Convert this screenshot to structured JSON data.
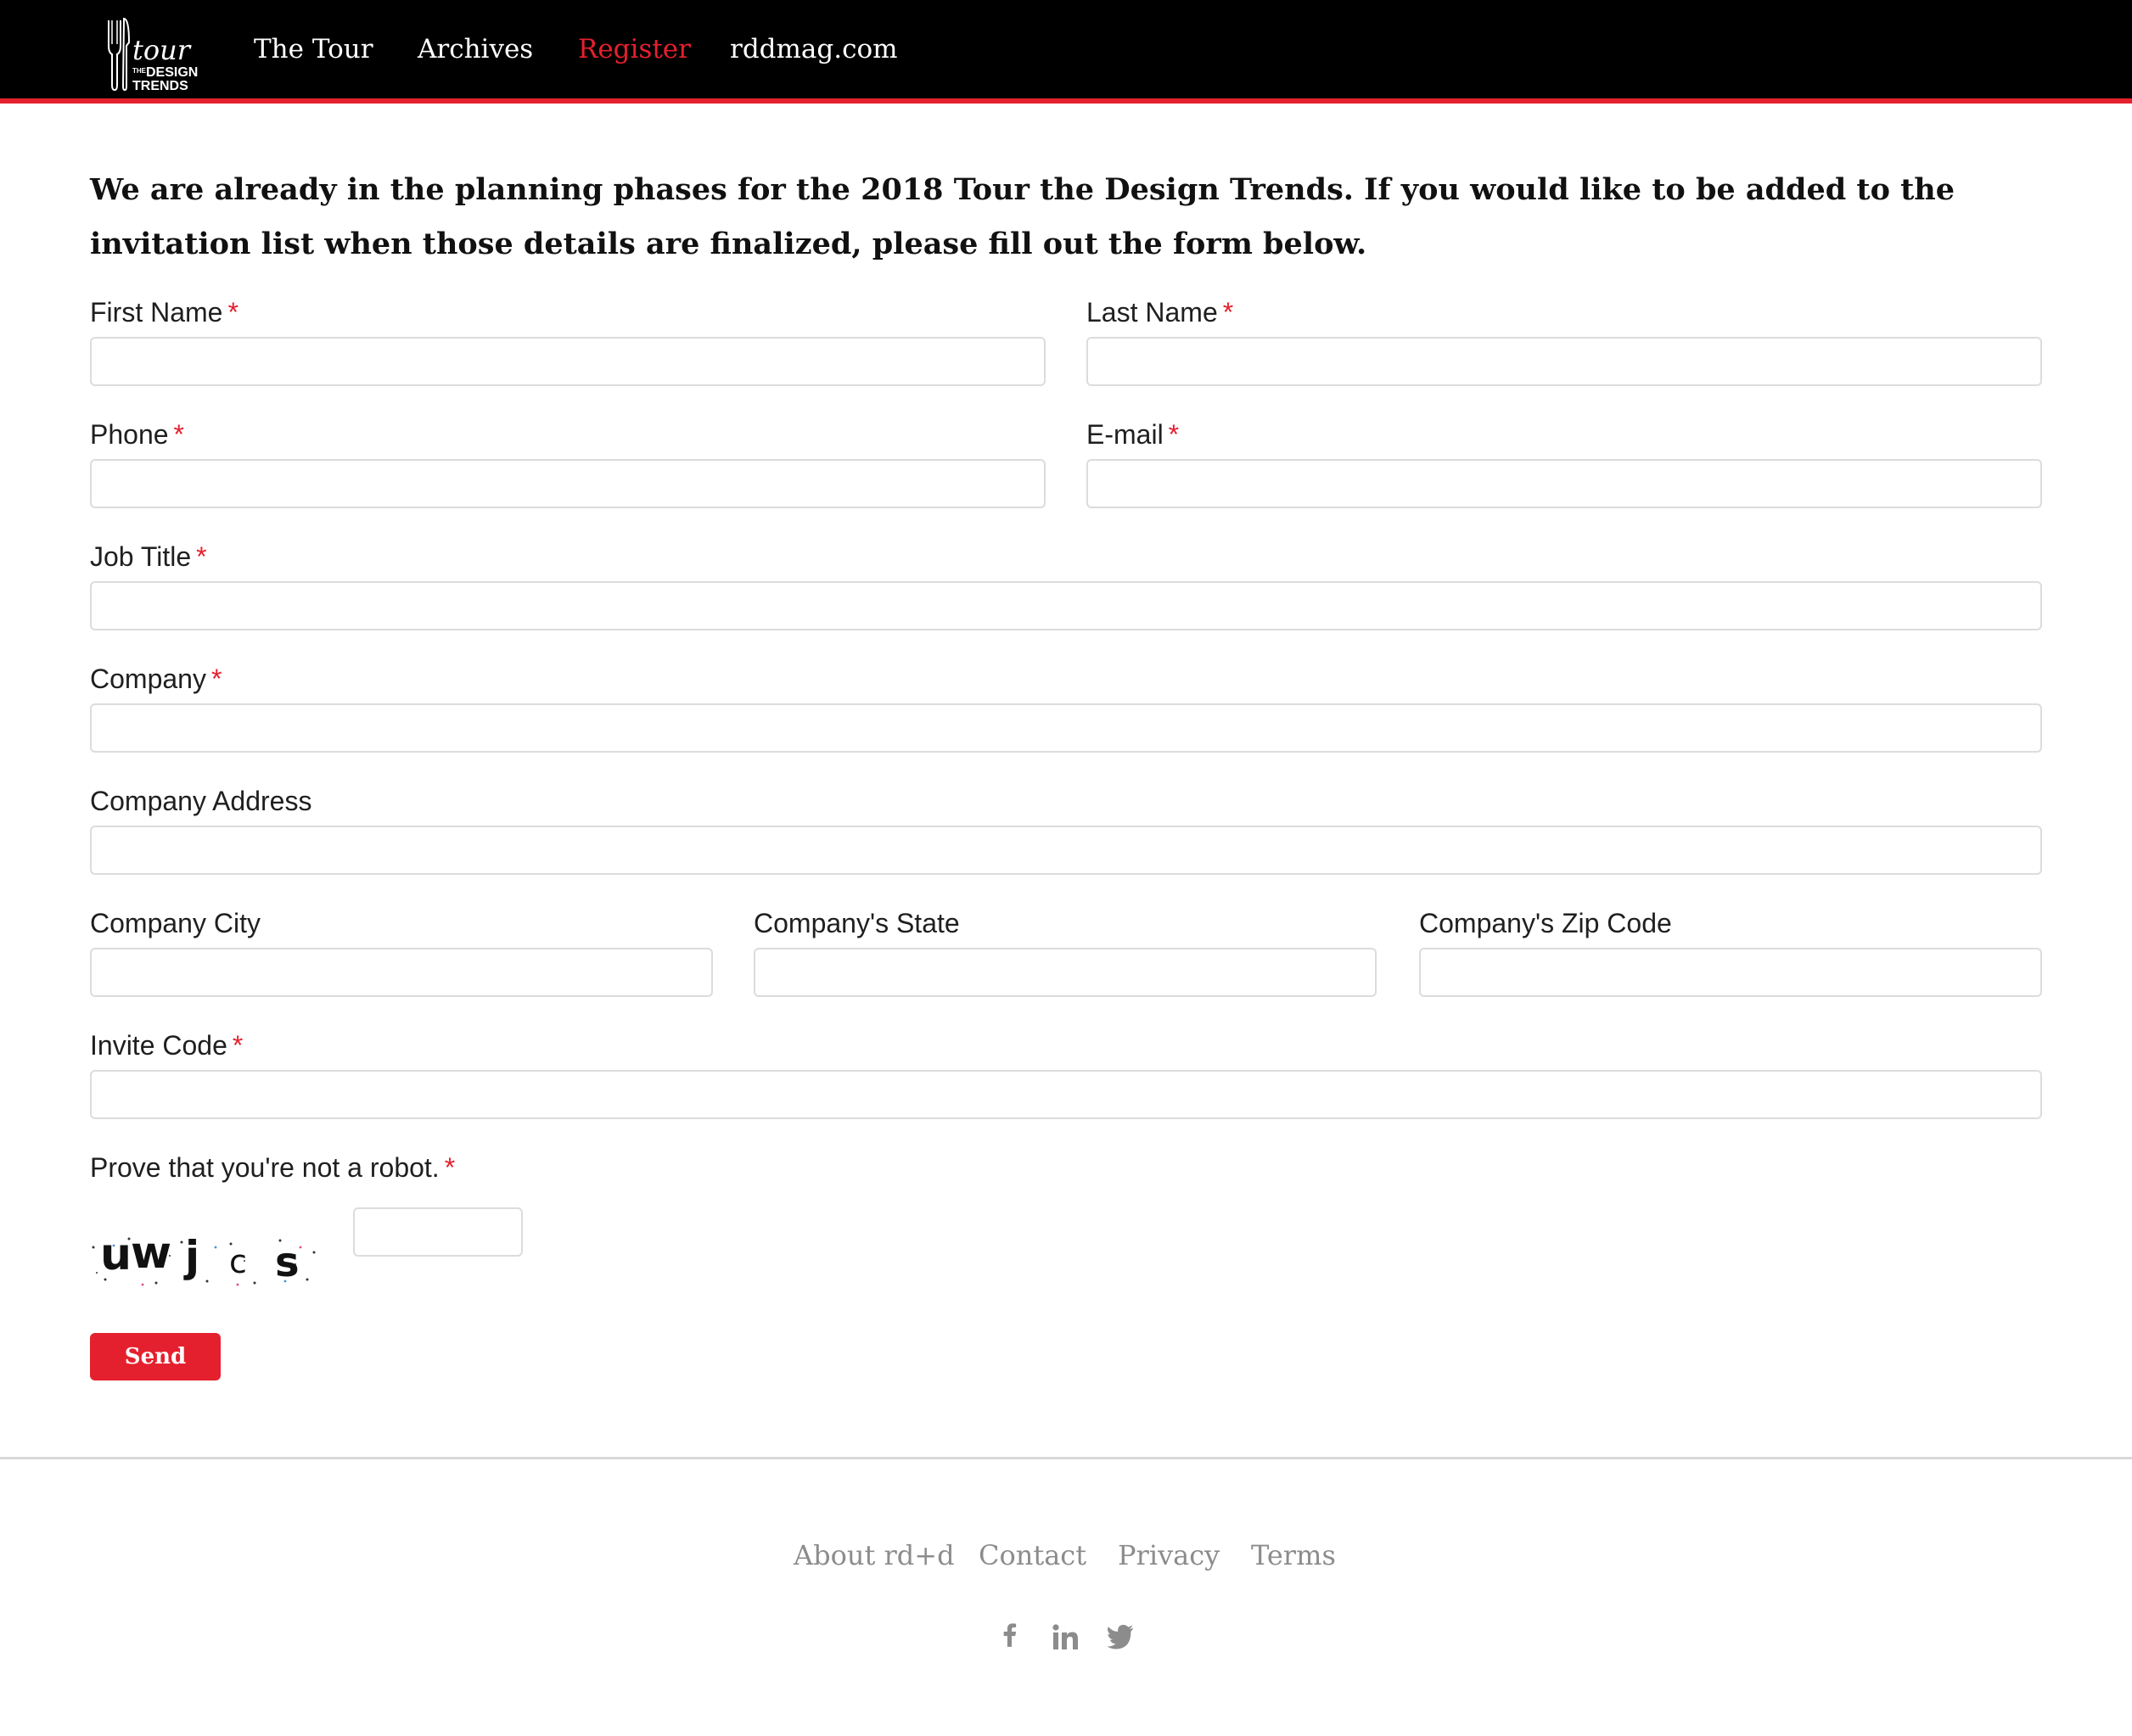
{
  "header": {
    "logo": {
      "word": "tour",
      "small": "THE",
      "line1": "DESIGN",
      "line2": "TRENDS"
    },
    "nav": [
      "The Tour",
      "Archives",
      "Register",
      "rddmag.com"
    ],
    "active_nav": "Register",
    "accent_color": "#e5202e"
  },
  "intro": "We are already in the planning phases for the 2018 Tour the Design Trends. If you would like to be added to the invitation list when those details are finalized, please fill out the form below.",
  "form": {
    "required_marker": "*",
    "first_name": {
      "label": "First Name",
      "value": ""
    },
    "last_name": {
      "label": "Last Name",
      "value": ""
    },
    "phone": {
      "label": "Phone",
      "value": ""
    },
    "email": {
      "label": "E-mail",
      "value": ""
    },
    "job_title": {
      "label": "Job Title",
      "value": ""
    },
    "company": {
      "label": "Company",
      "value": ""
    },
    "company_address": {
      "label": "Company Address",
      "value": ""
    },
    "company_city": {
      "label": "Company City",
      "value": ""
    },
    "company_state": {
      "label": "Company's State",
      "value": ""
    },
    "company_zip": {
      "label": "Company's Zip Code",
      "value": ""
    },
    "invite_code": {
      "label": "Invite Code",
      "value": ""
    },
    "captcha": {
      "label": "Prove that you're not a robot.",
      "text": "uwjcs",
      "value": ""
    },
    "send_label": "Send"
  },
  "footer": {
    "links": [
      "About rd+d",
      "Contact",
      "Privacy",
      "Terms"
    ],
    "social_icons": [
      "facebook-icon",
      "linkedin-icon",
      "twitter-icon"
    ]
  }
}
